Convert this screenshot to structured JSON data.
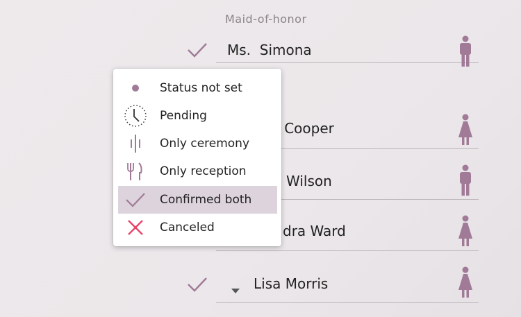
{
  "section": {
    "title": "Maid-of-honor"
  },
  "guests": [
    {
      "name": "Ms.  Simona",
      "gender": "male",
      "status": "confirmed"
    },
    {
      "name": "y Cooper",
      "gender": "female"
    },
    {
      "name": "Wilson",
      "gender": "male"
    },
    {
      "name": "dra Ward",
      "gender": "female"
    },
    {
      "name": "Lisa Morris",
      "gender": "female",
      "status": "confirmed"
    }
  ],
  "status_menu": {
    "items": [
      {
        "label": "Status not set",
        "icon": "dot-icon"
      },
      {
        "label": "Pending",
        "icon": "clock-icon"
      },
      {
        "label": "Only ceremony",
        "icon": "ceremony-icon"
      },
      {
        "label": "Only reception",
        "icon": "fork-knife-icon"
      },
      {
        "label": "Confirmed both",
        "icon": "check-icon",
        "selected": true
      },
      {
        "label": "Canceled",
        "icon": "x-icon"
      }
    ]
  },
  "colors": {
    "accent": "#a07a96",
    "cancel": "#e8436a",
    "selected_bg": "#ddd3dd"
  }
}
